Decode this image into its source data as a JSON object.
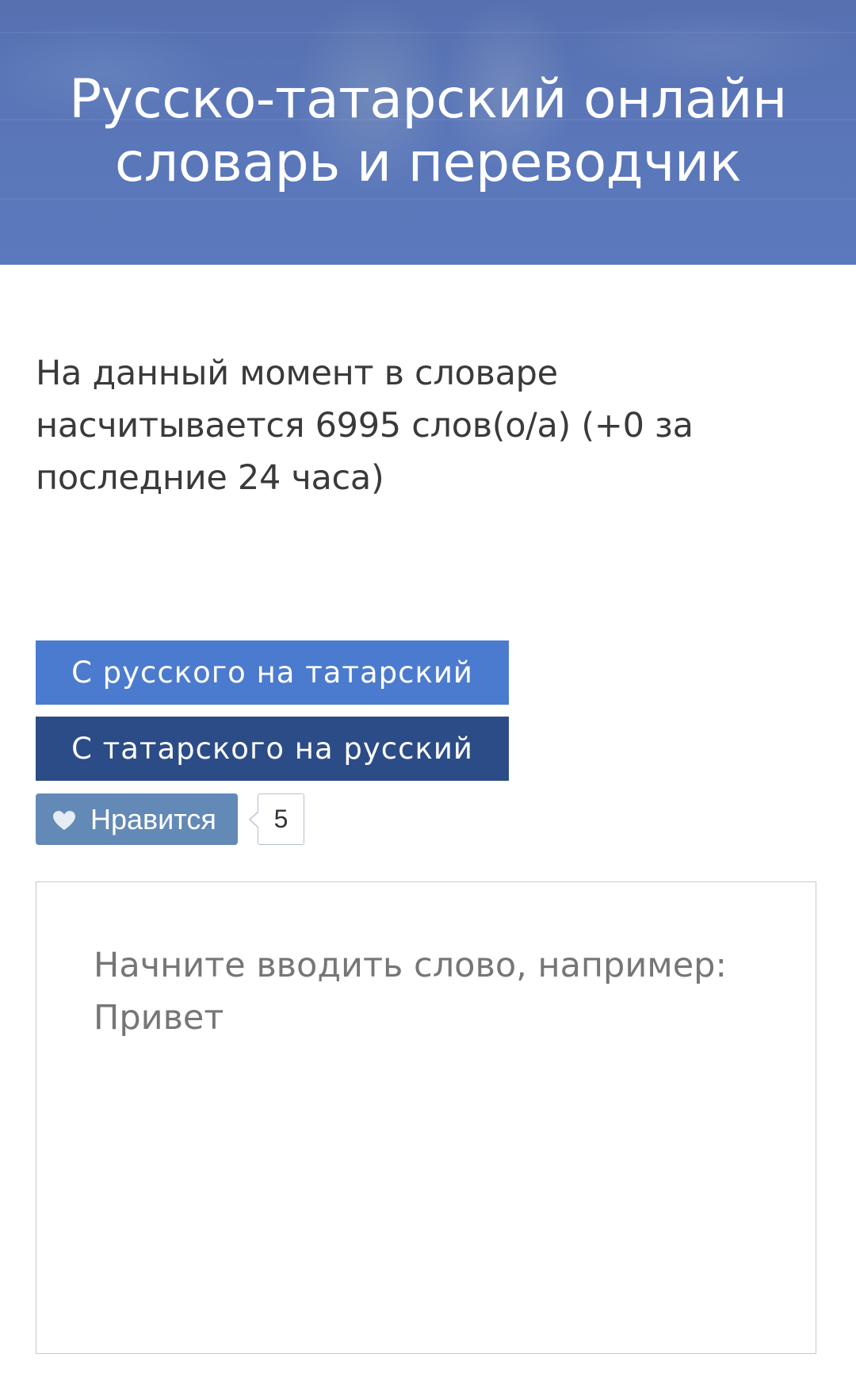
{
  "header": {
    "title": "Русско-татарский онлайн словарь и переводчик",
    "background_color": "#5a76b8"
  },
  "stats": {
    "text": "На данный момент в словаре насчитывается 6995 слов(о/а) (+0 за последние 24 часа)"
  },
  "direction_buttons": {
    "ru_to_tt": "С русского на татарский",
    "tt_to_ru": "С татарского на русский",
    "ru_to_tt_color": "#4b7bce",
    "tt_to_ru_color": "#2c4c87"
  },
  "like": {
    "label": "Нравится",
    "count": "5",
    "icon": "heart-icon",
    "button_color": "#6389b7"
  },
  "search": {
    "value": "",
    "placeholder": "Начните вводить слово, например: Привет"
  }
}
